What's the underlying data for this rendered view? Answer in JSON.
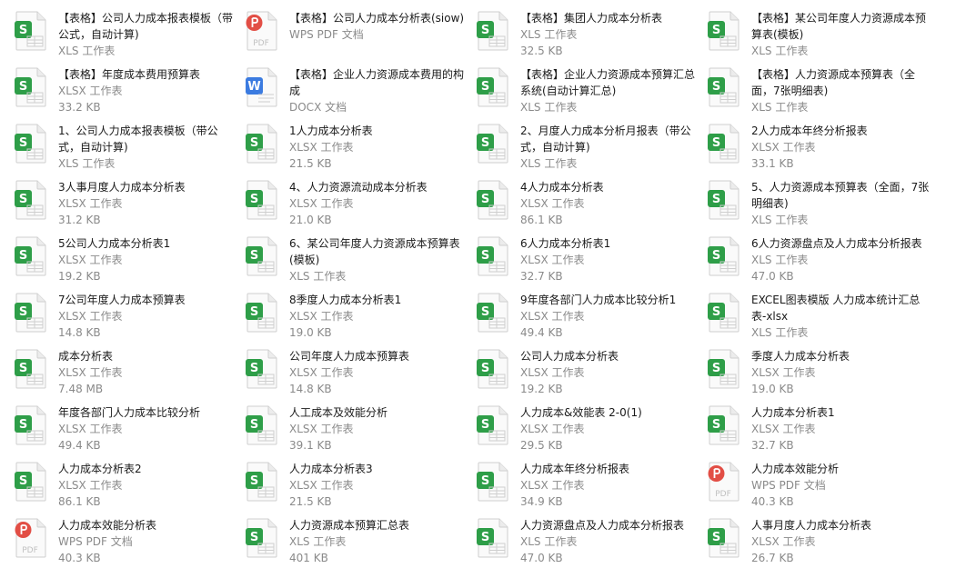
{
  "files": [
    {
      "name": "【表格】公司人力成本报表模板（带公式，自动计算)",
      "type": "XLS 工作表",
      "size": "",
      "icon": "xls"
    },
    {
      "name": "【表格】公司人力成本分析表(siow)",
      "type": "WPS PDF 文档",
      "size": "",
      "icon": "pdf"
    },
    {
      "name": "【表格】集团人力成本分析表",
      "type": "XLS 工作表",
      "size": "32.5 KB",
      "icon": "xls"
    },
    {
      "name": "【表格】某公司年度人力资源成本预算表(模板)",
      "type": "XLS 工作表",
      "size": "",
      "icon": "xls"
    },
    {
      "name": "【表格】年度成本费用预算表",
      "type": "XLSX 工作表",
      "size": "33.2 KB",
      "icon": "xls"
    },
    {
      "name": "【表格】企业人力资源成本费用的构成",
      "type": "DOCX 文档",
      "size": "",
      "icon": "doc"
    },
    {
      "name": "【表格】企业人力资源成本预算汇总系统(自动计算汇总)",
      "type": "XLS 工作表",
      "size": "",
      "icon": "xls"
    },
    {
      "name": "【表格】人力资源成本预算表（全面，7张明细表)",
      "type": "XLS 工作表",
      "size": "",
      "icon": "xls"
    },
    {
      "name": "1、公司人力成本报表模板（带公式，自动计算)",
      "type": "XLS 工作表",
      "size": "",
      "icon": "xls"
    },
    {
      "name": "1人力成本分析表",
      "type": "XLSX 工作表",
      "size": "21.5 KB",
      "icon": "xls"
    },
    {
      "name": "2、月度人力成本分析月报表（带公式，自动计算)",
      "type": "XLS 工作表",
      "size": "",
      "icon": "xls"
    },
    {
      "name": "2人力成本年终分析报表",
      "type": "XLSX 工作表",
      "size": "33.1 KB",
      "icon": "xls"
    },
    {
      "name": "3人事月度人力成本分析表",
      "type": "XLSX 工作表",
      "size": "31.2 KB",
      "icon": "xls"
    },
    {
      "name": "4、人力资源流动成本分析表",
      "type": "XLSX 工作表",
      "size": "21.0 KB",
      "icon": "xls"
    },
    {
      "name": "4人力成本分析表",
      "type": "XLSX 工作表",
      "size": "86.1 KB",
      "icon": "xls"
    },
    {
      "name": "5、人力资源成本预算表（全面，7张明细表)",
      "type": "XLS 工作表",
      "size": "",
      "icon": "xls"
    },
    {
      "name": "5公司人力成本分析表1",
      "type": "XLSX 工作表",
      "size": "19.2 KB",
      "icon": "xls"
    },
    {
      "name": "6、某公司年度人力资源成本预算表(模板)",
      "type": "XLS 工作表",
      "size": "",
      "icon": "xls"
    },
    {
      "name": "6人力成本分析表1",
      "type": "XLSX 工作表",
      "size": "32.7 KB",
      "icon": "xls"
    },
    {
      "name": "6人力资源盘点及人力成本分析报表",
      "type": "XLS 工作表",
      "size": "47.0 KB",
      "icon": "xls"
    },
    {
      "name": "7公司年度人力成本预算表",
      "type": "XLSX 工作表",
      "size": "14.8 KB",
      "icon": "xls"
    },
    {
      "name": "8季度人力成本分析表1",
      "type": "XLSX 工作表",
      "size": "19.0 KB",
      "icon": "xls"
    },
    {
      "name": "9年度各部门人力成本比较分析1",
      "type": "XLSX 工作表",
      "size": "49.4 KB",
      "icon": "xls"
    },
    {
      "name": "EXCEL图表模版 人力成本统计汇总表-xlsx",
      "type": "XLS 工作表",
      "size": "",
      "icon": "xls"
    },
    {
      "name": "成本分析表",
      "type": "XLSX 工作表",
      "size": "7.48 MB",
      "icon": "xls"
    },
    {
      "name": "公司年度人力成本预算表",
      "type": "XLSX 工作表",
      "size": "14.8 KB",
      "icon": "xls"
    },
    {
      "name": "公司人力成本分析表",
      "type": "XLSX 工作表",
      "size": "19.2 KB",
      "icon": "xls"
    },
    {
      "name": "季度人力成本分析表",
      "type": "XLSX 工作表",
      "size": "19.0 KB",
      "icon": "xls"
    },
    {
      "name": "年度各部门人力成本比较分析",
      "type": "XLSX 工作表",
      "size": "49.4 KB",
      "icon": "xls"
    },
    {
      "name": "人工成本及效能分析",
      "type": "XLSX 工作表",
      "size": "39.1 KB",
      "icon": "xls"
    },
    {
      "name": "人力成本&效能表 2-0(1)",
      "type": "XLSX 工作表",
      "size": "29.5 KB",
      "icon": "xls"
    },
    {
      "name": "人力成本分析表1",
      "type": "XLSX 工作表",
      "size": "32.7 KB",
      "icon": "xls"
    },
    {
      "name": "人力成本分析表2",
      "type": "XLSX 工作表",
      "size": "86.1 KB",
      "icon": "xls"
    },
    {
      "name": "人力成本分析表3",
      "type": "XLSX 工作表",
      "size": "21.5 KB",
      "icon": "xls"
    },
    {
      "name": "人力成本年终分析报表",
      "type": "XLSX 工作表",
      "size": "34.9 KB",
      "icon": "xls"
    },
    {
      "name": "人力成本效能分析",
      "type": "WPS PDF 文档",
      "size": "40.3 KB",
      "icon": "pdf"
    },
    {
      "name": "人力成本效能分析表",
      "type": "WPS PDF 文档",
      "size": "40.3 KB",
      "icon": "pdf"
    },
    {
      "name": "人力资源成本预算汇总表",
      "type": "XLS 工作表",
      "size": "401 KB",
      "icon": "xls"
    },
    {
      "name": "人力资源盘点及人力成本分析报表",
      "type": "XLS 工作表",
      "size": "47.0 KB",
      "icon": "xls"
    },
    {
      "name": "人事月度人力成本分析表",
      "type": "XLSX 工作表",
      "size": "26.7 KB",
      "icon": "xls"
    }
  ],
  "icon_labels": {
    "xls": "S",
    "doc": "W",
    "pdf_text": "PDF"
  },
  "colors": {
    "xls": "#2e9e48",
    "doc": "#3b7be0",
    "pdf": "#e24e45",
    "name": "#1a1a1a",
    "meta": "#8a8a8a"
  }
}
